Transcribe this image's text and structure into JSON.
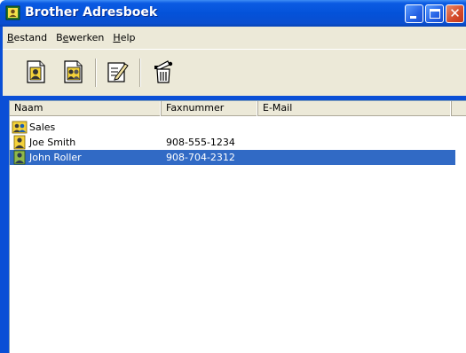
{
  "window": {
    "title": "Brother Adresboek",
    "title_icon": "address-book-icon",
    "controls": [
      "minimize-icon",
      "maximize-icon",
      "close-icon"
    ]
  },
  "menu": {
    "items": [
      {
        "label_pre": "",
        "label_u": "B",
        "label_post": "estand"
      },
      {
        "label_pre": "B",
        "label_u": "e",
        "label_post": "werken"
      },
      {
        "label_pre": "",
        "label_u": "H",
        "label_post": "elp"
      }
    ]
  },
  "toolbar": {
    "buttons": [
      "new-member-icon",
      "new-group-icon",
      "edit-icon",
      "delete-icon"
    ]
  },
  "list": {
    "columns": [
      "Naam",
      "Faxnummer",
      "E-Mail"
    ],
    "rows": [
      {
        "icon": "group-icon",
        "name": "Sales",
        "fax": "",
        "email": "",
        "selected": false
      },
      {
        "icon": "person-icon",
        "name": "Joe Smith",
        "fax": "908-555-1234",
        "email": "",
        "selected": false
      },
      {
        "icon": "person-icon",
        "name": "John Roller",
        "fax": "908-704-2312",
        "email": "",
        "selected": true
      }
    ]
  },
  "colors": {
    "titlebar": "#0452d9",
    "selection": "#316ac5",
    "chrome": "#ece9d8"
  }
}
